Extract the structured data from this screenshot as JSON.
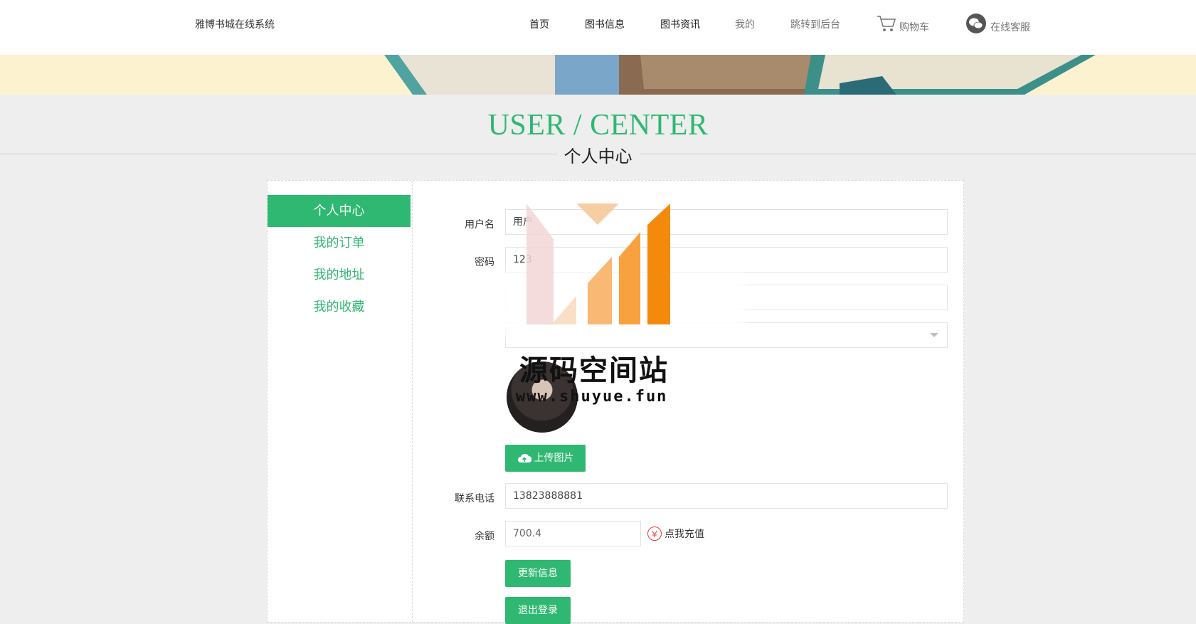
{
  "header": {
    "brand": "雅博书城在线系统",
    "nav": [
      "首页",
      "图书信息",
      "图书资讯",
      "我的",
      "跳转到后台"
    ],
    "cart_label": "购物车",
    "service_label": "在线客服"
  },
  "heading": {
    "title_en": "USER / CENTER",
    "title_cn": "个人中心"
  },
  "sidebar": {
    "items": [
      {
        "label": "个人中心",
        "active": true
      },
      {
        "label": "我的订单",
        "active": false
      },
      {
        "label": "我的地址",
        "active": false
      },
      {
        "label": "我的收藏",
        "active": false
      }
    ]
  },
  "form": {
    "username_label": "用户名",
    "username_value": "用户",
    "password_label": "密码",
    "password_value": "123",
    "phone_label": "联系电话",
    "phone_value": "13823888881",
    "balance_label": "余额",
    "balance_value": "700.4",
    "upload_label": "上传图片",
    "recharge_label": "点我充值",
    "recharge_icon": "￥",
    "update_label": "更新信息",
    "logout_label": "退出登录"
  },
  "watermark": {
    "name": "源码空间站",
    "url": "www.shuyue.fun"
  },
  "colors": {
    "accent": "#2fb872",
    "banner": "#fdf2cf",
    "page_bg": "#eeeeee"
  }
}
